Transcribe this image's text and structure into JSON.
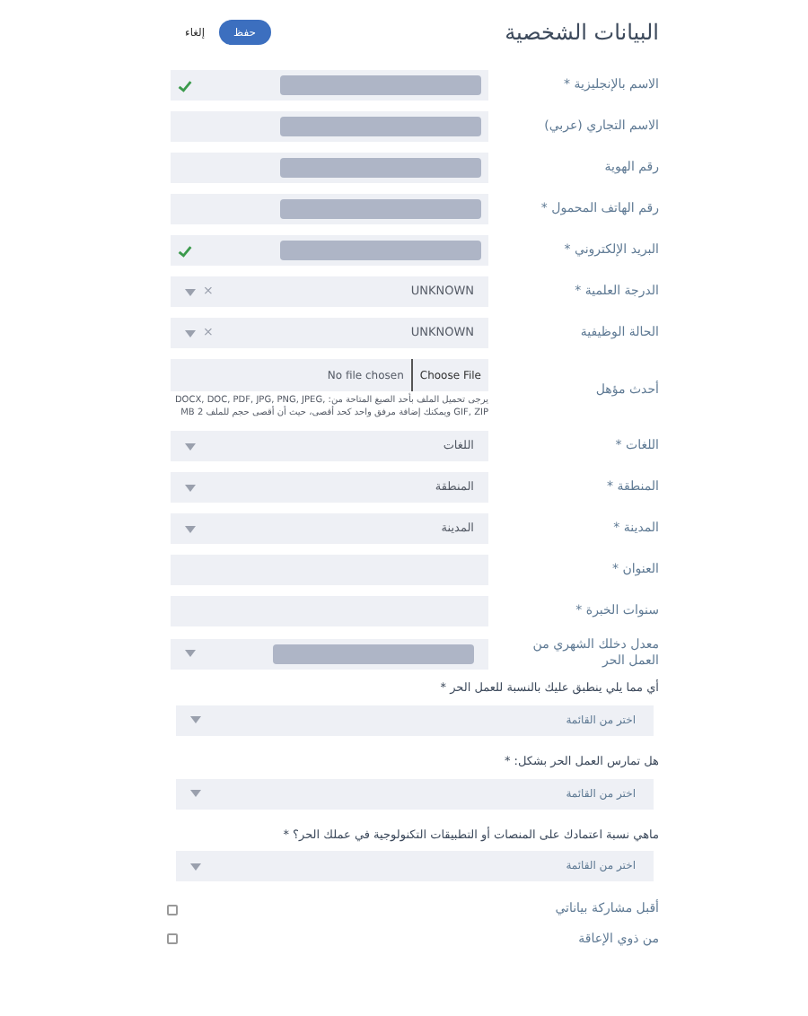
{
  "header": {
    "title": "البيانات الشخصية",
    "save_button": "حفظ",
    "cancel_link": "إلغاء"
  },
  "fields": [
    {
      "kind": "text",
      "label": "الاسم بالإنجليزية *",
      "redacted": true,
      "valid": true
    },
    {
      "kind": "text",
      "label": "الاسم التجاري (عربي)",
      "redacted": true,
      "valid": false
    },
    {
      "kind": "text",
      "label": "رقم الهوية",
      "redacted": true,
      "valid": false
    },
    {
      "kind": "text",
      "label": "رقم الهاتف المحمول *",
      "redacted": true,
      "valid": false
    },
    {
      "kind": "text",
      "label": "البريد الإلكتروني *",
      "redacted": true,
      "valid": true
    },
    {
      "kind": "select",
      "label": "الدرجة العلمية *",
      "value": "UNKNOWN",
      "clear_icon": "×"
    },
    {
      "kind": "select",
      "label": "الحالة الوظيفية",
      "value": "UNKNOWN",
      "clear_icon": "×"
    },
    {
      "kind": "file",
      "label": "أحدث مؤهل",
      "button": "Choose File",
      "status": "No file chosen",
      "hint": "يرجى تحميل الملف بأحد الصيغ المتاحة من: DOCX, DOC, PDF, JPG, PNG, JPEG, GIF, ZIP ويمكنك إضافة مرفق واحد كحد أقصى، حيث أن أقصى حجم للملف 2 MB"
    },
    {
      "kind": "select",
      "label": "اللغات *",
      "value": "اللغات"
    },
    {
      "kind": "select",
      "label": "المنطقة *",
      "value": "المنطقة"
    },
    {
      "kind": "select",
      "label": "المدينة *",
      "value": "المدينة"
    },
    {
      "kind": "text",
      "label": "العنوان *",
      "redacted": false,
      "valid": false
    },
    {
      "kind": "text",
      "label": "سنوات الخبرة *",
      "redacted": false,
      "valid": false
    },
    {
      "kind": "select",
      "label": "معدل دخلك الشهري من العمل الحر",
      "redacted": true
    }
  ],
  "questions": [
    {
      "label": "أي مما يلي ينطبق عليك بالنسبة للعمل الحر *",
      "placeholder": "اختر من القائمة"
    },
    {
      "label": "هل تمارس العمل الحر بشكل: *",
      "placeholder": "اختر من القائمة"
    },
    {
      "label": "ماهي نسبة اعتمادك على المنصات أو التطبيقات التكنولوجية في عملك الحر؟ *",
      "placeholder": "اختر من القائمة"
    }
  ],
  "checkboxes": [
    {
      "label": "أقبل مشاركة بياناتي",
      "checked": false
    },
    {
      "label": "من ذوي الإعاقة",
      "checked": false
    }
  ]
}
